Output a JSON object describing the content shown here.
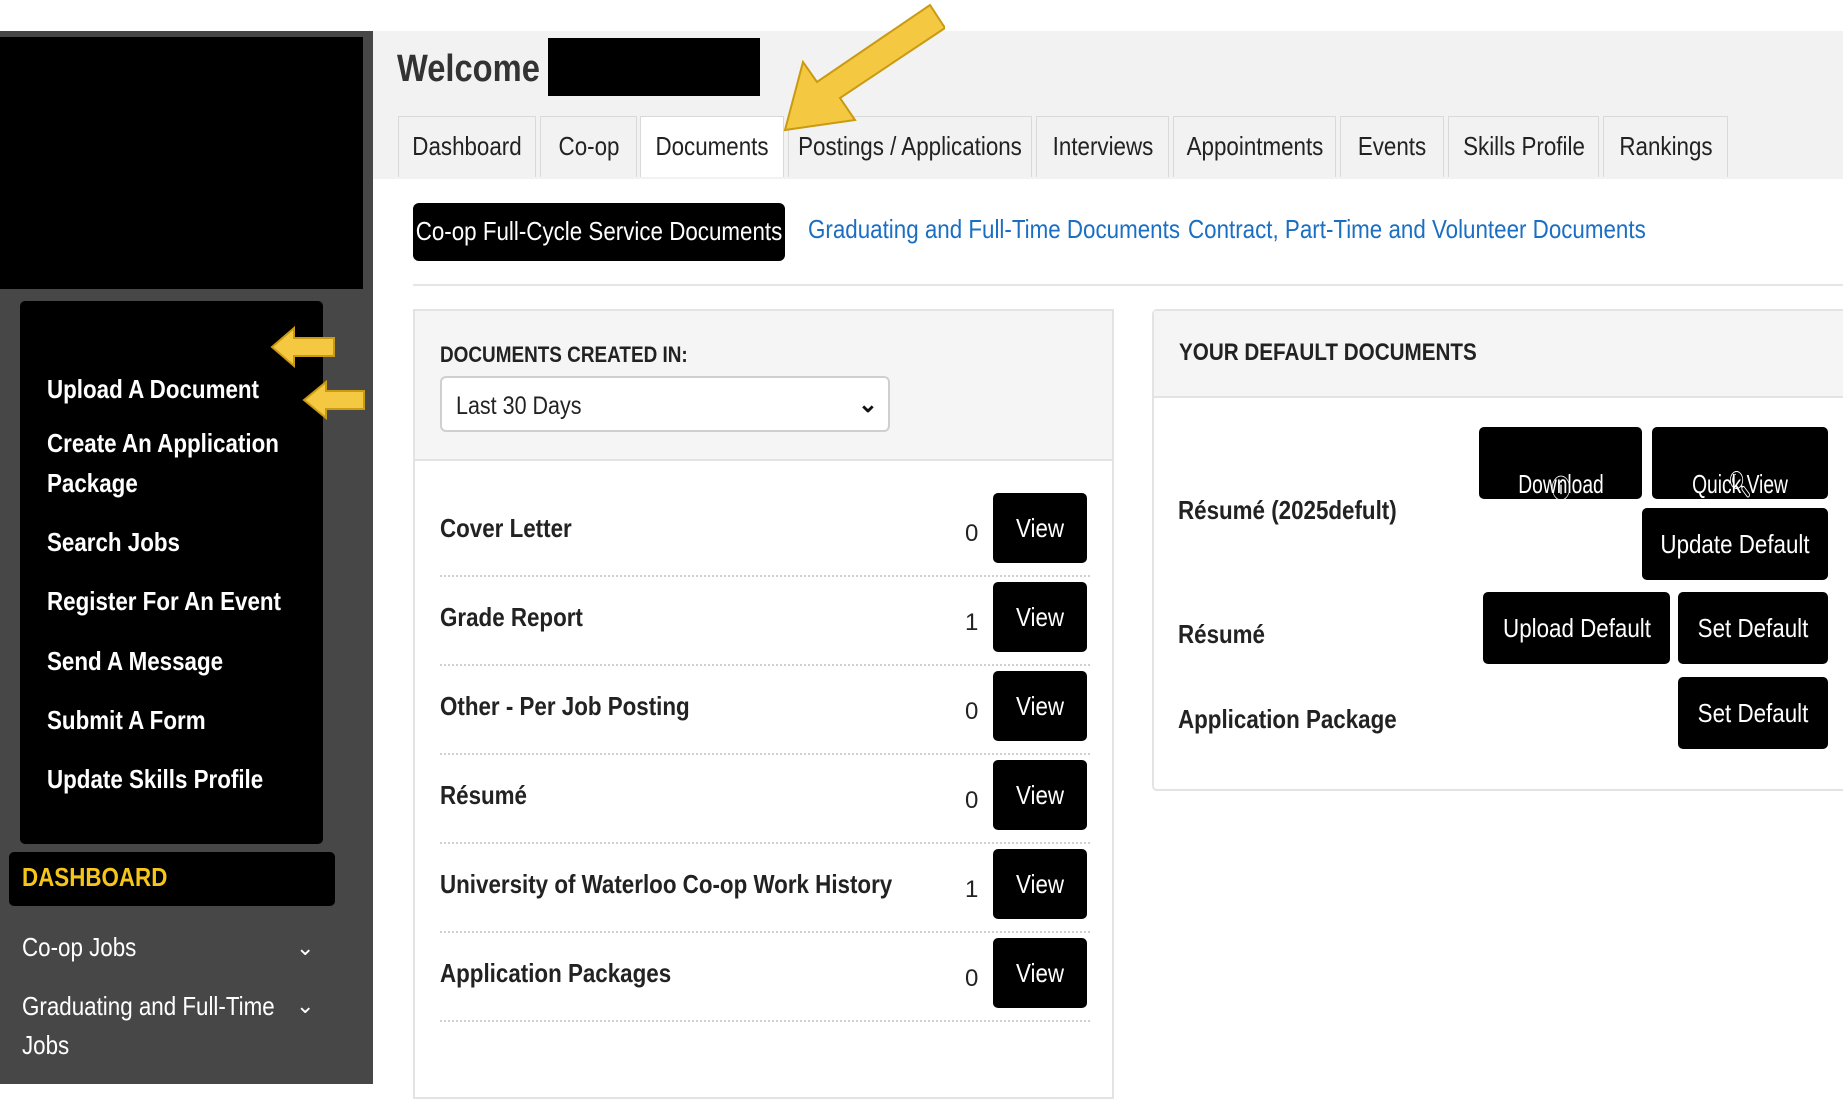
{
  "welcome": {
    "text": "Welcome"
  },
  "tabs": [
    {
      "label": "Dashboard"
    },
    {
      "label": "Co-op"
    },
    {
      "label": "Documents"
    },
    {
      "label": "Postings / Applications"
    },
    {
      "label": "Interviews"
    },
    {
      "label": "Appointments"
    },
    {
      "label": "Events"
    },
    {
      "label": "Skills Profile"
    },
    {
      "label": "Rankings"
    }
  ],
  "subtabs": [
    {
      "label": "Co-op Full-Cycle Service Documents",
      "active": true
    },
    {
      "label": "Graduating and Full-Time Documents"
    },
    {
      "label": "Contract, Part-Time and Volunteer Documents"
    }
  ],
  "quick_actions": [
    {
      "label": "Upload A Document"
    },
    {
      "label": "Create An Application"
    },
    {
      "label": "Package"
    },
    {
      "label": "Search Jobs"
    },
    {
      "label": "Register For An Event"
    },
    {
      "label": "Send A Message"
    },
    {
      "label": "Submit A Form"
    },
    {
      "label": "Update Skills Profile"
    }
  ],
  "dashboard_nav": {
    "heading": "DASHBOARD",
    "items": [
      {
        "label": "Co-op Jobs"
      },
      {
        "label": "Graduating and Full-Time"
      },
      {
        "label": "Jobs"
      }
    ]
  },
  "documents_filter": {
    "label": "DOCUMENTS CREATED IN:",
    "selected": "Last 30 Days"
  },
  "documents": {
    "view_label": "View",
    "rows": [
      {
        "name": "Cover Letter",
        "count": "0"
      },
      {
        "name": "Grade Report",
        "count": "1"
      },
      {
        "name": "Other - Per Job Posting",
        "count": "0"
      },
      {
        "name": "Résumé",
        "count": "0"
      },
      {
        "name": "University of Waterloo Co-op Work History",
        "count": "1"
      },
      {
        "name": "Application Packages",
        "count": "0"
      }
    ]
  },
  "default_docs": {
    "heading": "YOUR DEFAULT DOCUMENTS",
    "resume_2025": "Résumé (2025defult)",
    "download": "Download",
    "quick_view": "Quick View",
    "update_default": "Update Default",
    "resume": "Résumé",
    "upload_default": "Upload Default",
    "set_default": "Set Default",
    "application_package": "Application Package",
    "set_default_2": "Set Default"
  },
  "colors": {
    "accent_arrow": "#f5c842",
    "link": "#1a6fc4",
    "sidebar": "#474747"
  }
}
